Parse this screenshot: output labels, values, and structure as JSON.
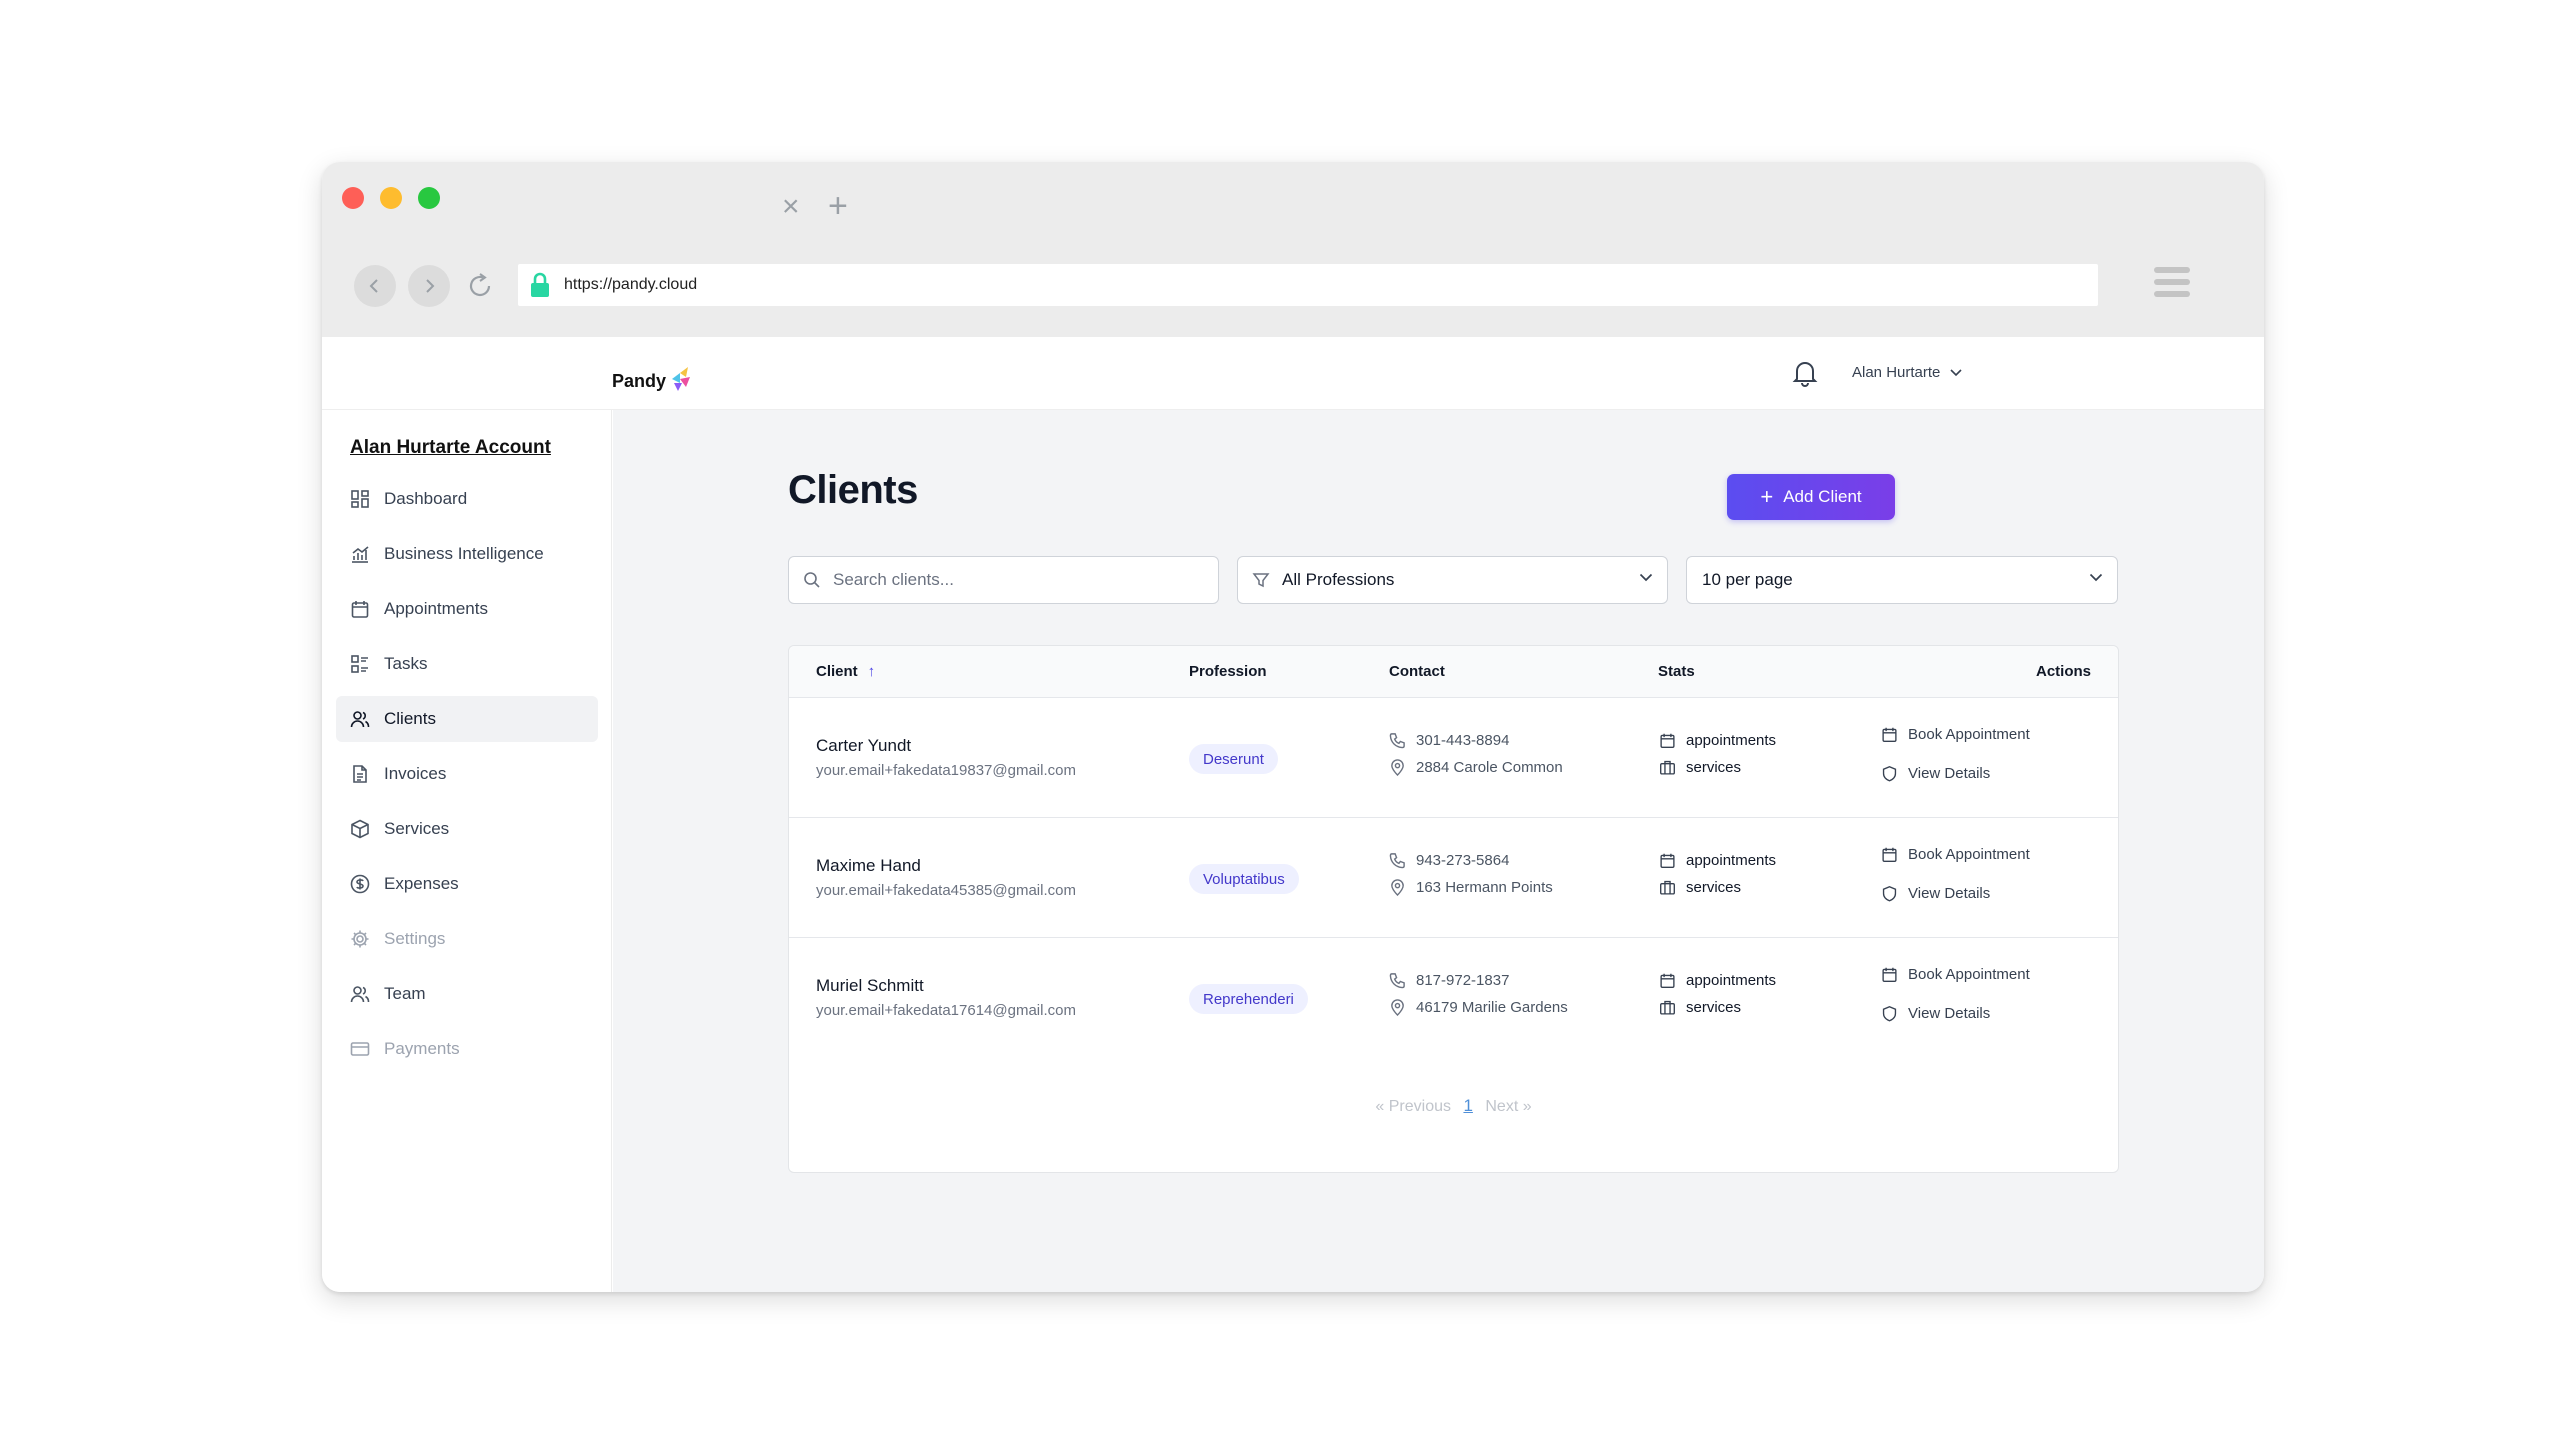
{
  "browser": {
    "url": "https://pandy.cloud",
    "colors": {
      "close": "#fe5f57",
      "minimize": "#febc2e",
      "maximize": "#28c840"
    }
  },
  "app": {
    "logo_text": "Pandy",
    "user_name": "Alan Hurtarte"
  },
  "sidebar": {
    "account_title": "Alan Hurtarte Account",
    "items": [
      {
        "label": "Dashboard",
        "icon": "dashboard-icon"
      },
      {
        "label": "Business Intelligence",
        "icon": "chart-icon"
      },
      {
        "label": "Appointments",
        "icon": "calendar-icon"
      },
      {
        "label": "Tasks",
        "icon": "tasks-icon"
      },
      {
        "label": "Clients",
        "icon": "users-icon",
        "active": true
      },
      {
        "label": "Invoices",
        "icon": "invoice-icon"
      },
      {
        "label": "Services",
        "icon": "box-icon"
      },
      {
        "label": "Expenses",
        "icon": "dollar-icon"
      },
      {
        "label": "Settings",
        "icon": "gear-icon",
        "muted": true
      },
      {
        "label": "Team",
        "icon": "team-icon"
      },
      {
        "label": "Payments",
        "icon": "card-icon",
        "muted": true
      }
    ]
  },
  "main": {
    "title": "Clients",
    "add_button": "Add Client",
    "search_placeholder": "Search clients...",
    "profession_filter": "All Professions",
    "per_page": "10 per page",
    "accent": "#5b4df0"
  },
  "table": {
    "headers": {
      "client": "Client",
      "profession": "Profession",
      "contact": "Contact",
      "stats": "Stats",
      "actions": "Actions"
    },
    "rows": [
      {
        "name": "Carter Yundt",
        "email": "your.email+fakedata19837@gmail.com",
        "profession": "Deserunt",
        "phone": "301-443-8894",
        "address": "2884 Carole Common",
        "stat1": "appointments",
        "stat2": "services",
        "action1": "Book Appointment",
        "action2": "View Details"
      },
      {
        "name": "Maxime Hand",
        "email": "your.email+fakedata45385@gmail.com",
        "profession": "Voluptatibus",
        "phone": "943-273-5864",
        "address": "163 Hermann Points",
        "stat1": "appointments",
        "stat2": "services",
        "action1": "Book Appointment",
        "action2": "View Details"
      },
      {
        "name": "Muriel Schmitt",
        "email": "your.email+fakedata17614@gmail.com",
        "profession": "Reprehenderi",
        "phone": "817-972-1837",
        "address": "46179 Marilie Gardens",
        "stat1": "appointments",
        "stat2": "services",
        "action1": "Book Appointment",
        "action2": "View Details"
      }
    ]
  },
  "pagination": {
    "previous": "« Previous",
    "current": "1",
    "next": "Next »"
  }
}
